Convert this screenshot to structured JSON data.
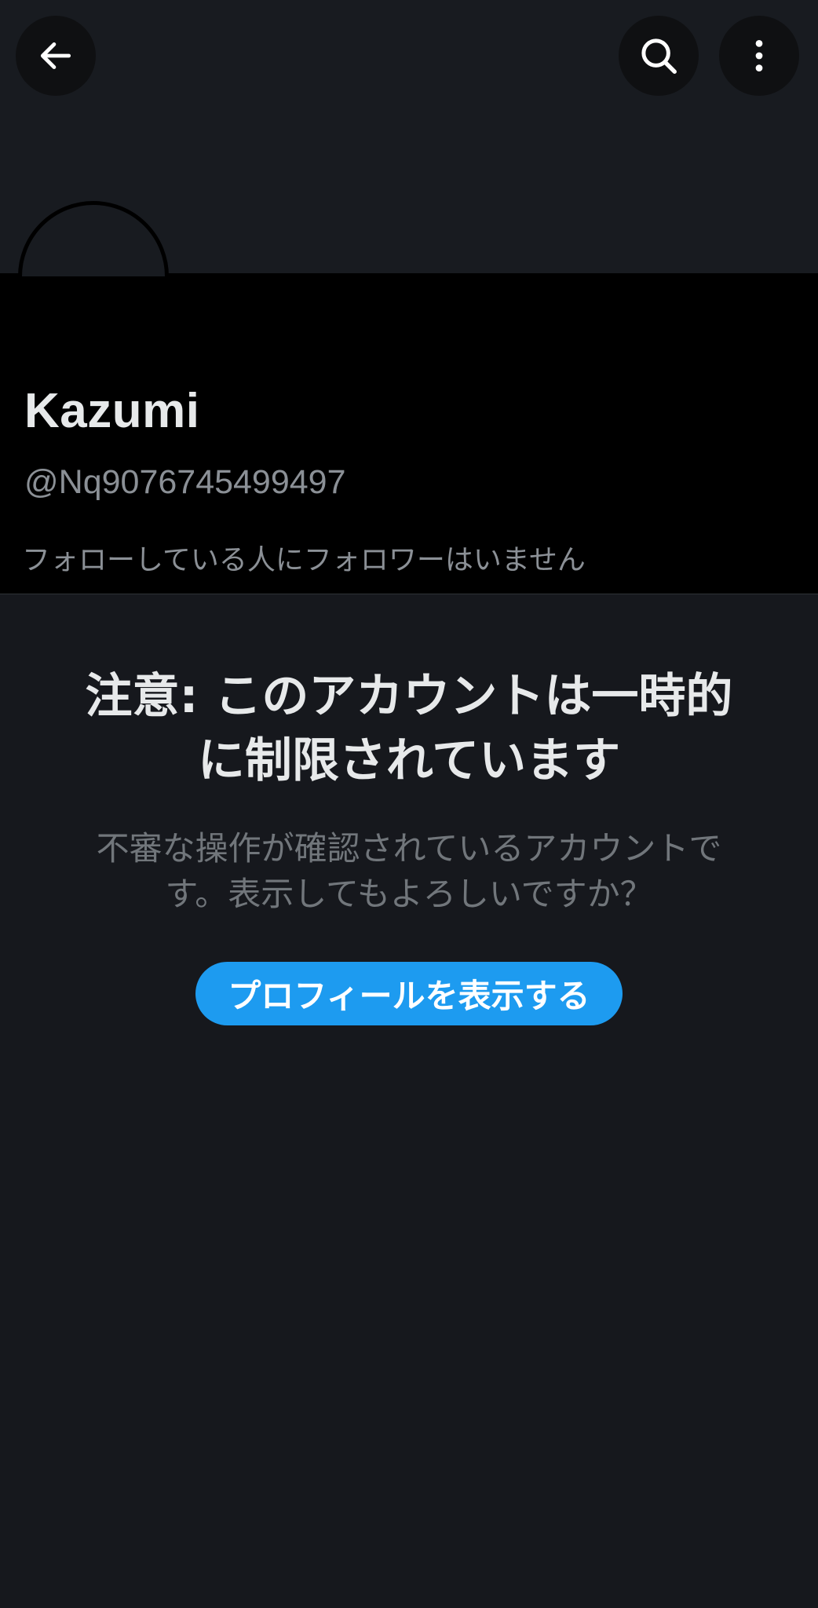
{
  "header": {
    "back_icon": "arrow-left-icon",
    "search_icon": "search-icon",
    "more_icon": "more-vertical-icon"
  },
  "profile": {
    "display_name": "Kazumi",
    "handle": "@Nq9076745499497",
    "follow_note": "フォローしている人にフォロワーはいません"
  },
  "warning": {
    "title_line1": "注意: このアカウントは一時的",
    "title_line2": "に制限されています",
    "desc_line1": "不審な操作が確認されているアカウントで",
    "desc_line2": "す。表示してもよろしいですか？",
    "view_button_label": "プロフィールを表示する"
  },
  "colors": {
    "background": "#16181d",
    "profile_band": "#000000",
    "accent": "#1d9bf0",
    "primary_text": "#e7e9ea",
    "secondary_text": "#8b9096"
  }
}
